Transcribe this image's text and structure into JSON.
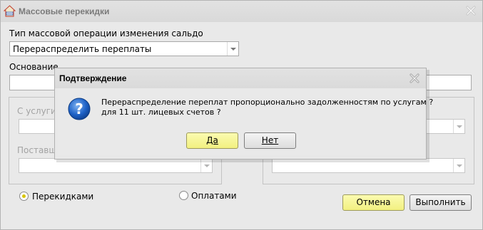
{
  "window": {
    "title": "Массовые перекидки"
  },
  "form": {
    "operation_type_label": "Тип массовой операции изменения сальдо",
    "operation_type_value": "Перераспределить переплаты",
    "basis_label": "Основание",
    "basis_value": "",
    "from_service_label": "С услуги",
    "supplier_label": "Поставщ",
    "radio_transfers_label": "Перекидками",
    "radio_payments_label": "Оплатами",
    "radio_selected": "transfers",
    "cancel_label": "Отмена",
    "execute_label": "Выполнить"
  },
  "dialog": {
    "title": "Подтверждение",
    "message_line1": "Перераспределение переплат пропорционально задолженностям по услугам ?",
    "message_line2": "для 11 шт. лицевых счетов ?",
    "yes_label": "Да",
    "no_label": "Нет",
    "icon": "question-icon"
  },
  "colors": {
    "accent_yellow": "#f2f080",
    "window_bg": "#e9e9e9",
    "question_blue": "#1f63c8"
  }
}
